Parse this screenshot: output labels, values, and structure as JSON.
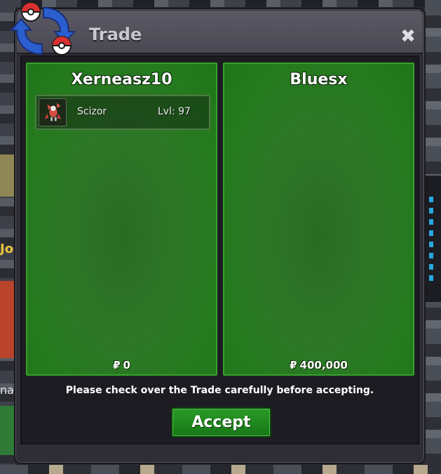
{
  "window": {
    "title": "Trade",
    "close_glyph": "✖",
    "icons": [
      "pokeball-trade-icon",
      "close-icon"
    ]
  },
  "left_party": {
    "name": "Xerneasz10",
    "items": [
      {
        "name": "Scizor",
        "level": "Lvl: 97",
        "icon": "scizor-sprite-icon"
      }
    ],
    "money_symbol": "₽",
    "money": "0"
  },
  "right_party": {
    "name": "Bluesx",
    "items": [],
    "money_symbol": "₽",
    "money": "400,000"
  },
  "notice": "Please check over the Trade carefully before accepting.",
  "accept_label": "Accept",
  "background": {
    "fragment_left_1": "Jo",
    "fragment_left_2": "na"
  },
  "colors": {
    "panel_green": "#2d7727",
    "accept_green": "#1f8a1e",
    "window_frame": "#2f2e36"
  }
}
